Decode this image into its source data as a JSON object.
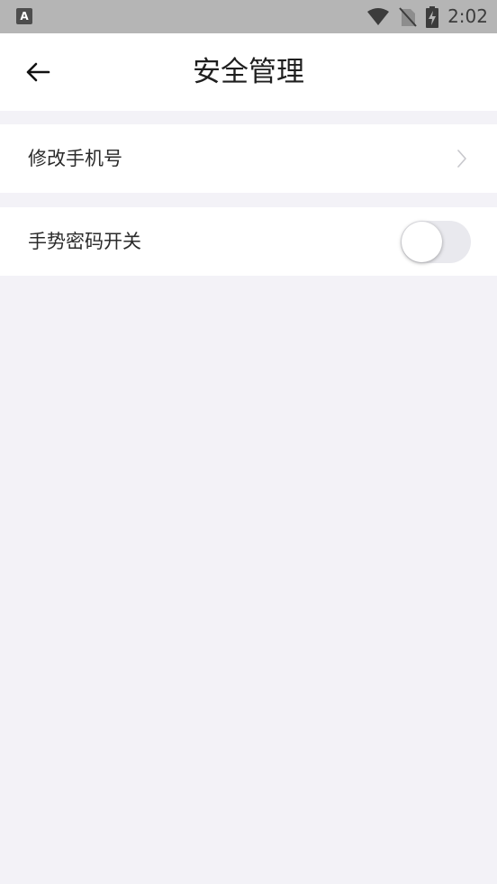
{
  "status_bar": {
    "app_icon_letter": "A",
    "time": "2:02"
  },
  "header": {
    "title": "安全管理",
    "back_icon": "arrow-left-icon"
  },
  "settings": {
    "change_phone": {
      "label": "修改手机号",
      "icon": "chevron-right-icon"
    },
    "gesture_password": {
      "label": "手势密码开关",
      "enabled": false
    }
  },
  "colors": {
    "status_bar": "#b5b5b5",
    "background": "#f3f2f7",
    "card": "#ffffff",
    "toggle_off_track": "#e9e9ee"
  }
}
